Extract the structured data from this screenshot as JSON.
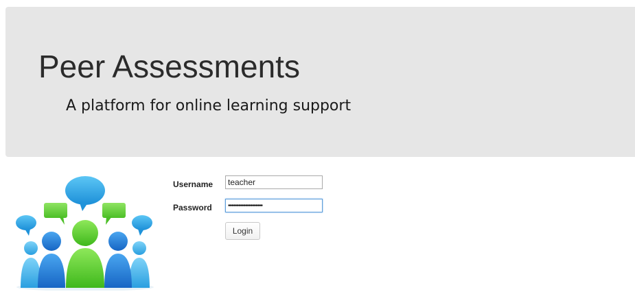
{
  "header": {
    "title": "Peer Assessments",
    "subtitle": "A platform for online learning support"
  },
  "login_form": {
    "username_label": "Username",
    "username_value": "teacher",
    "password_label": "Password",
    "password_value": "••••••••••••••••••••",
    "login_button_label": "Login"
  },
  "logo": {
    "icon": "people-chat-bubbles-logo",
    "colors": {
      "bubble_blue": "#29a8e8",
      "bubble_green": "#6fd33b",
      "person_green": "#5ccf2f",
      "person_blue": "#1e7fd6",
      "person_light_blue": "#3cb2ec"
    }
  }
}
